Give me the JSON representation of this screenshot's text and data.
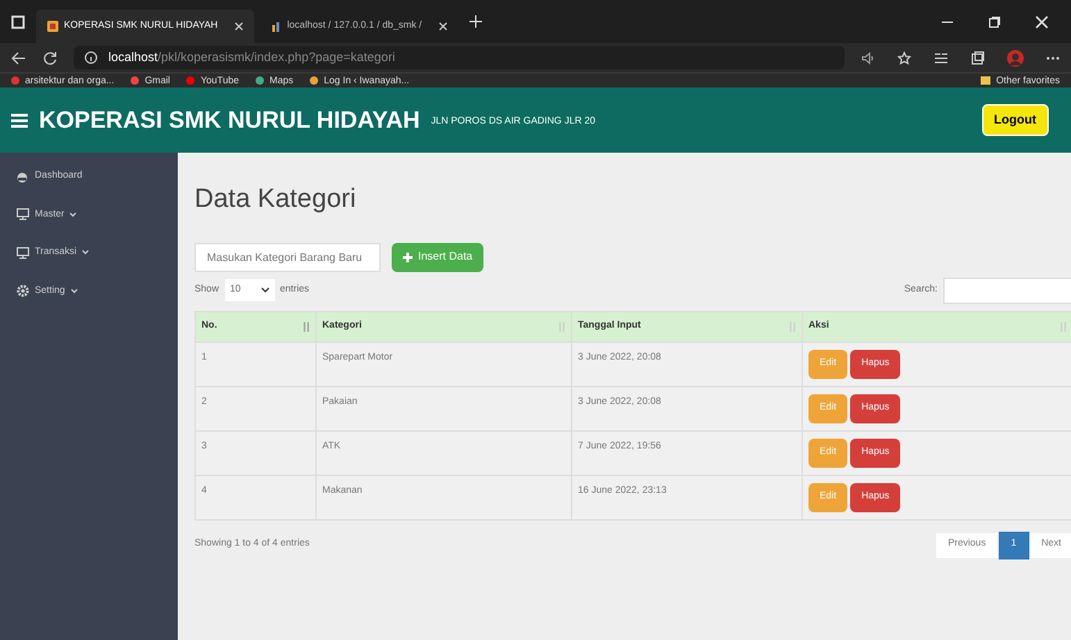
{
  "browser": {
    "tabs": [
      {
        "title": "KOPERASI SMK NURUL HIDAYAH",
        "selected": true
      },
      {
        "title": "localhost / 127.0.0.1 / db_smk /",
        "selected": false
      }
    ],
    "url_host": "localhost",
    "url_path": "/pkl/koperasismk/index.php?page=kategori",
    "bookmarks": [
      "arsitektur dan orga...",
      "Gmail",
      "YouTube",
      "Maps",
      "Log In ‹ Iwanayah..."
    ],
    "other_favorites": "Other favorites"
  },
  "header": {
    "title": "KOPERASI SMK NURUL HIDAYAH",
    "subtitle": "JLN POROS DS AIR GADING JLR 20",
    "logout": "Logout"
  },
  "sidebar": {
    "items": [
      {
        "label": "Dashboard",
        "kind": "dashboard"
      },
      {
        "label": "Master",
        "kind": "monitor"
      },
      {
        "label": "Transaksi",
        "kind": "monitor"
      },
      {
        "label": "Setting",
        "kind": "gear"
      }
    ]
  },
  "page": {
    "title": "Data Kategori",
    "new_category": {
      "placeholder": "Masukan Kategori Barang Baru"
    },
    "insert_button": "Insert Data",
    "show_label": "Show",
    "entries_value": "10",
    "entries_label": "entries",
    "search_label": "Search:",
    "table": {
      "columns": [
        "No.",
        "Kategori",
        "Tanggal Input",
        "Aksi"
      ],
      "rows": [
        {
          "no": "1",
          "kategori": "Sparepart Motor",
          "tanggal": "3 June 2022, 20:08",
          "edit": "Edit",
          "delete": "Hapus"
        },
        {
          "no": "2",
          "kategori": "Pakaian",
          "tanggal": "3 June 2022, 20:08",
          "edit": "Edit",
          "delete": "Hapus"
        },
        {
          "no": "3",
          "kategori": "ATK",
          "tanggal": "7 June 2022, 19:56",
          "edit": "Edit",
          "delete": "Hapus"
        },
        {
          "no": "4",
          "kategori": "Makanan",
          "tanggal": "16 June 2022, 23:13",
          "edit": "Edit",
          "delete": "Hapus"
        }
      ]
    },
    "info": "Showing 1 to 4 of 4 entries",
    "pagination": [
      {
        "label": "Previous",
        "selected": false
      },
      {
        "label": "1",
        "selected": true
      },
      {
        "label": "Next",
        "selected": false
      }
    ]
  }
}
